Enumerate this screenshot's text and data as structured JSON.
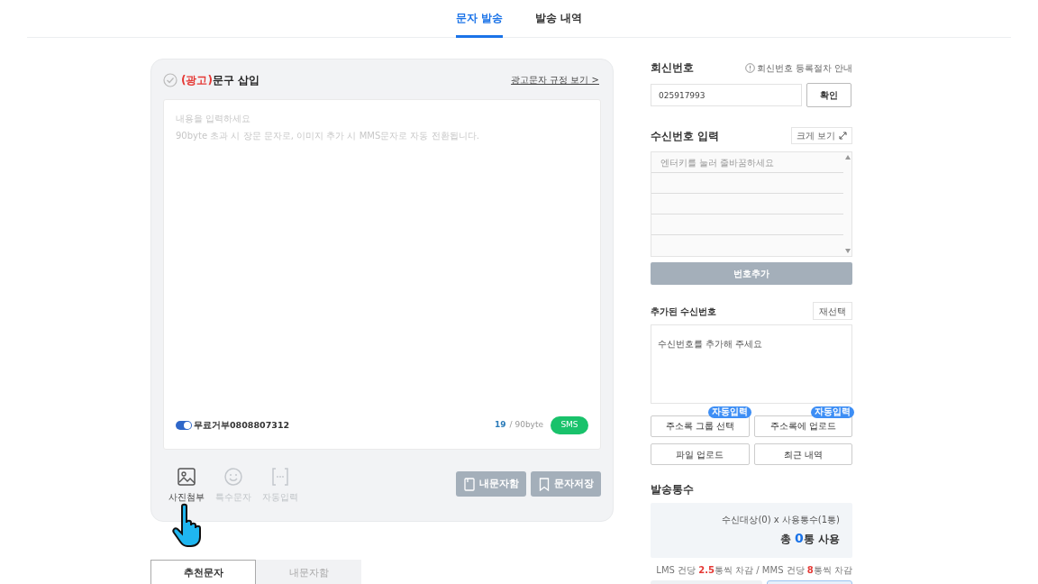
{
  "top_tabs": [
    {
      "label": "문자 발송",
      "selected": true
    },
    {
      "label": "발송 내역",
      "selected": false
    }
  ],
  "composer": {
    "ad_checked": false,
    "ad_prefix": "(광고)",
    "title": "문구 삽입",
    "rules_link": "광고문자 규정 보기 >",
    "placeholder_lines": [
      "내용을 입력하세요",
      "90byte 초과 시 장문 문자로, 이미지 추가 시 MMS문자로 자동 전환됩니다."
    ],
    "opt_out": {
      "on": true,
      "label": "무료거부0808807312"
    },
    "byte_count": "19",
    "byte_limit": "/ 90byte",
    "type_badge": "SMS",
    "tools": [
      {
        "label": "사진첨부",
        "kind": "image",
        "disabled": false
      },
      {
        "label": "특수문자",
        "kind": "emoji",
        "disabled": true
      },
      {
        "label": "자동입력",
        "kind": "auto",
        "disabled": true
      }
    ],
    "actions": [
      {
        "label": "내문자함",
        "kind": "inbox"
      },
      {
        "label": "문자저장",
        "kind": "bookmark"
      }
    ]
  },
  "bottom_tabs": [
    {
      "label": "추천문자",
      "selected": true
    },
    {
      "label": "내문자함",
      "selected": false
    }
  ],
  "reply_number": {
    "heading": "회신번호",
    "guide": "회신번호 등록절차 안내",
    "value": "025917993",
    "confirm": "확인"
  },
  "recipients": {
    "heading": "수신번호 입력",
    "expand": "크게 보기",
    "placeholder": "엔터키를 눌러 줄바꿈하세요",
    "add": "번호추가"
  },
  "added": {
    "heading": "추가된 수신번호",
    "reselect": "재선택",
    "placeholder": "수신번호를 추가해 주세요"
  },
  "source_buttons": [
    {
      "label": "주소록 그룹 선택",
      "badge": "자동입력"
    },
    {
      "label": "주소록에 업로드",
      "badge": "자동입력"
    },
    {
      "label": "파일 업로드"
    },
    {
      "label": "최근 내역"
    }
  ],
  "send_count": {
    "heading": "발송통수",
    "formula": "수신대상(0) x 사용통수(1통)",
    "total_prefix": "총 ",
    "total_count": "0",
    "total_suffix": "통 사용",
    "note": [
      {
        "text": "LMS 건당 ",
        "emph": false
      },
      {
        "text": "2.5",
        "emph": true
      },
      {
        "text": "통씩 차감 / MMS 건당 ",
        "emph": false
      },
      {
        "text": "8",
        "emph": true
      },
      {
        "text": "통씩 차감",
        "emph": false
      }
    ]
  }
}
